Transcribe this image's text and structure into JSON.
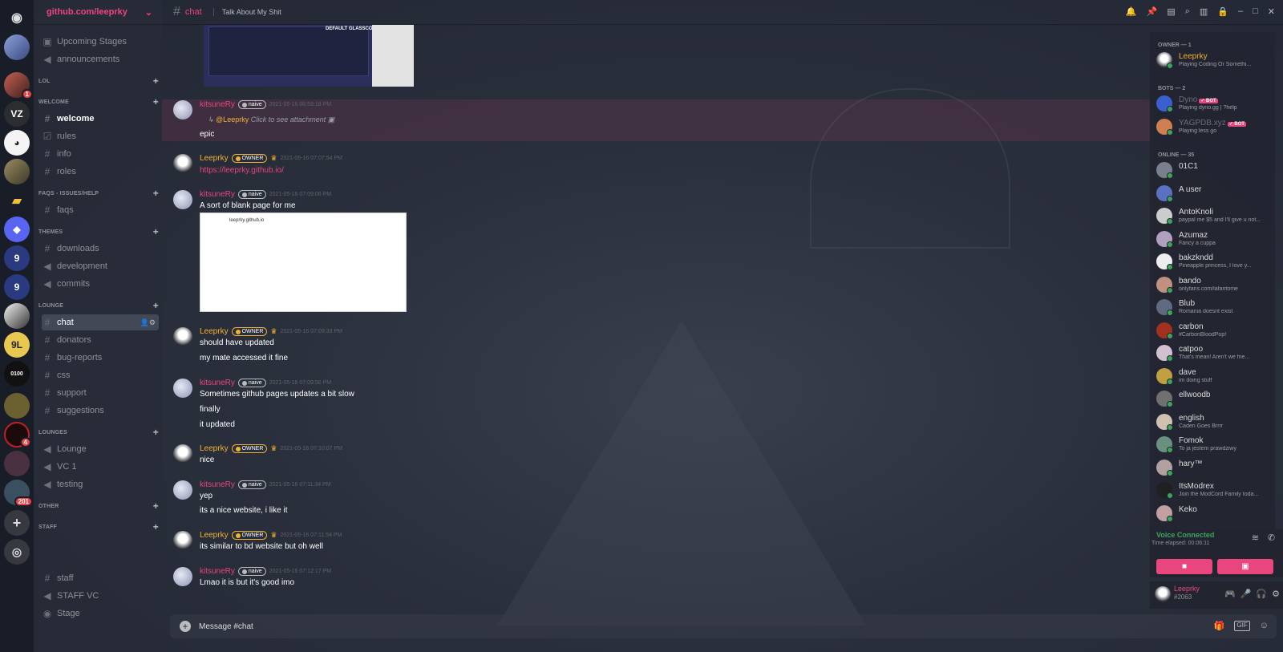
{
  "guild": {
    "name": "github.com/leeprky"
  },
  "server_badges": {
    "s2": "1",
    "s12": "4",
    "s14": "201"
  },
  "channels": {
    "top": [
      "Upcoming Stages",
      "announcements"
    ],
    "cats": {
      "lol": "LOL",
      "welcome": "WELCOME",
      "faqs": "FAQS - ISSUES/HELP",
      "themes": "THEMES",
      "lounge": "LOUNGE",
      "lounges": "LOUNGES",
      "other": "OTHER",
      "staff": "STAFF"
    },
    "welcome": [
      "welcome",
      "rules",
      "info",
      "roles"
    ],
    "faqs": [
      "faqs"
    ],
    "themes": [
      "downloads",
      "development",
      "commits"
    ],
    "lounge": [
      "chat",
      "donators",
      "bug-reports",
      "css",
      "support",
      "suggestions"
    ],
    "lounges": [
      "Lounge",
      "VC 1",
      "testing"
    ],
    "staff": [
      "staff",
      "STAFF VC",
      "Stage"
    ]
  },
  "topbar": {
    "channel": "chat",
    "topic": "Talk About My Shit"
  },
  "attachment_label": "DEFAULT GLASSCORD",
  "messages": {
    "m1": {
      "author": "kitsuneRy",
      "tag": "naive",
      "time": "2021-05-16 06:59:18 PM",
      "reply_to": "@Leeprky",
      "reply_text": "Click to see attachment",
      "lines": [
        "epic"
      ]
    },
    "m2": {
      "author": "Leeprky",
      "tag": "OWNER",
      "time": "2021-05-16 07:07:54 PM",
      "link": "https://leeprky.github.io/"
    },
    "m3": {
      "author": "kitsuneRy",
      "tag": "naive",
      "time": "2021-05-16 07:09:06 PM",
      "lines": [
        "A sort of blank page for me"
      ],
      "image_text": "leeprky.github.io"
    },
    "m4": {
      "author": "Leeprky",
      "tag": "OWNER",
      "time": "2021-05-16 07:09:33 PM",
      "lines": [
        "should have updated",
        "my mate accessed it fine"
      ]
    },
    "m5": {
      "author": "kitsuneRy",
      "tag": "naive",
      "time": "2021-05-16 07:09:56 PM",
      "lines": [
        "Sometimes github pages updates a bit slow",
        "finally",
        "it updated"
      ]
    },
    "m6": {
      "author": "Leeprky",
      "tag": "OWNER",
      "time": "2021-05-16 07:10:07 PM",
      "lines": [
        "nice"
      ]
    },
    "m7": {
      "author": "kitsuneRy",
      "tag": "naive",
      "time": "2021-05-16 07:11:34 PM",
      "lines": [
        "yep",
        "its a nice website, i like it"
      ]
    },
    "m8": {
      "author": "Leeprky",
      "tag": "OWNER",
      "time": "2021-05-16 07:11:54 PM",
      "lines": [
        "its similar to bd website but oh well"
      ]
    },
    "m9": {
      "author": "kitsuneRy",
      "tag": "naive",
      "time": "2021-05-16 07:12:17 PM",
      "lines": [
        "Lmao it is but it's good imo"
      ]
    }
  },
  "composer": {
    "placeholder": "Message #chat",
    "gif": "GIF"
  },
  "members": {
    "owner_cat": "OWNER — 1",
    "bots_cat": "BOTS — 2",
    "online_cat": "ONLINE — 35",
    "bot_badge": "✓ BOT",
    "list": [
      {
        "name": "Leeprky",
        "status": "Playing Coding Or Somethi..."
      },
      {
        "name": "Dyno",
        "status": "Playing dyno.gg | ?help"
      },
      {
        "name": "YAGPDB.xyz",
        "status": "Playing less go"
      },
      {
        "name": "01C1",
        "status": ""
      },
      {
        "name": "A user",
        "status": ""
      },
      {
        "name": "AntoKnoli",
        "status": "paypal me $5 and I'll give u not..."
      },
      {
        "name": "Azumaz",
        "status": "Fancy a cuppa"
      },
      {
        "name": "bakzkndd",
        "status": "Pineapple princess, I love y..."
      },
      {
        "name": "bando",
        "status": "onlyfans.com/lafantome"
      },
      {
        "name": "Blub",
        "status": "Romania doesnt exist"
      },
      {
        "name": "carbon",
        "status": "#CarbonBloodPop!"
      },
      {
        "name": "catpoo",
        "status": "That's mean! Aren't we frie..."
      },
      {
        "name": "dave",
        "status": "im doing stuff"
      },
      {
        "name": "ellwoodb",
        "status": ""
      },
      {
        "name": "english",
        "status": "Caden Goes Brrrr"
      },
      {
        "name": "Fomok",
        "status": "To ja jestem prawdziwy"
      },
      {
        "name": "hary™",
        "status": ""
      },
      {
        "name": "ItsModrex",
        "status": "Join the ModCord Family toda..."
      },
      {
        "name": "Keko",
        "status": ""
      }
    ]
  },
  "voice": {
    "title": "Voice Connected",
    "sub": "Time elapsed: 00:06:11"
  },
  "user": {
    "name": "Leeprky",
    "disc": "#2063"
  },
  "colors": {
    "accent": "#e8467c",
    "owner": "#f0b232",
    "online": "#3ba55c"
  }
}
